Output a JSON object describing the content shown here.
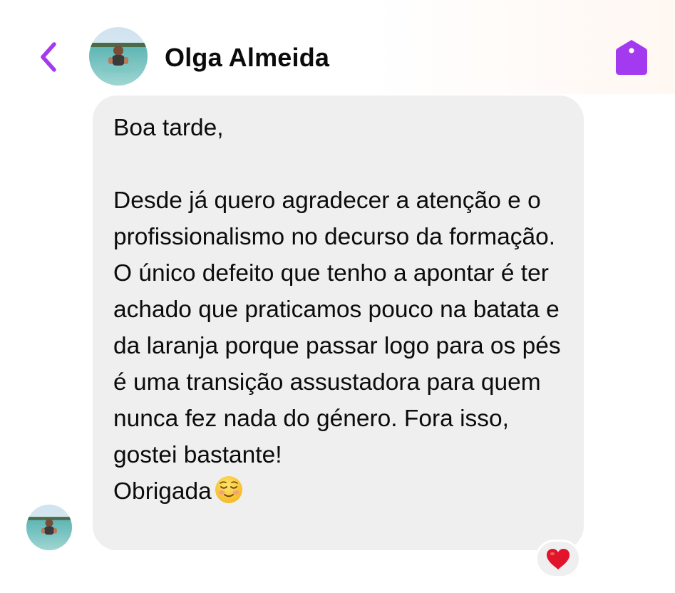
{
  "header": {
    "back_icon": "chevron-left-icon",
    "contact_name": "Olga Almeida",
    "avatar_icon": "profile-photo-icon",
    "tag_icon": "tag-icon"
  },
  "message": {
    "text": "Boa tarde,\n\nDesde já quero agradecer a atenção e o profissionalismo no decurso da formação. O único defeito que tenho a apontar é ter achado que praticamos pouco na batata e da laranja porque passar logo para os pés é uma transição assustadora para quem nunca fez nada do género. Fora isso, gostei bastante!\nObrigada",
    "emoji_icon": "smiling-face-icon",
    "reaction_icon": "red-heart-icon"
  },
  "colors": {
    "accent": "#a43af0",
    "bubble": "#efeff0",
    "reaction_heart": "#e0142a"
  }
}
